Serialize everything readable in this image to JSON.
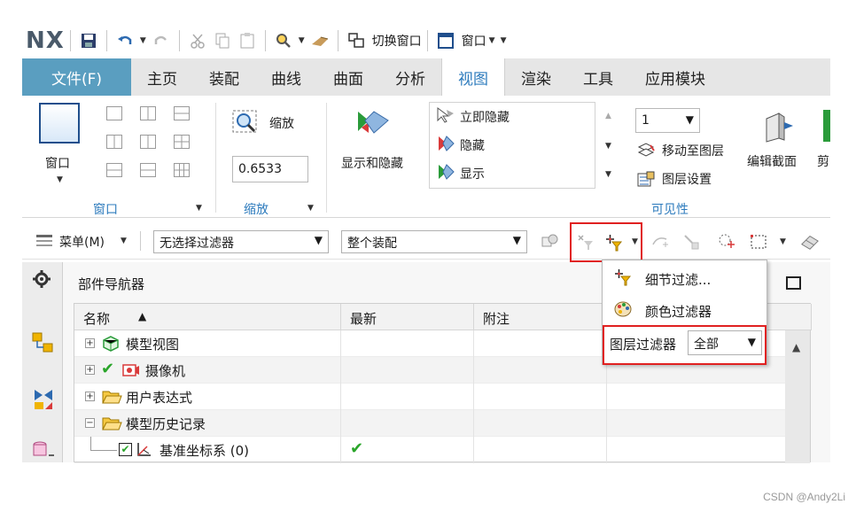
{
  "app": {
    "logo": "NX",
    "quick_access": {
      "switch_window": "切换窗口",
      "window_menu": "窗口"
    }
  },
  "tabs": [
    {
      "label": "文件(F)"
    },
    {
      "label": "主页"
    },
    {
      "label": "装配"
    },
    {
      "label": "曲线"
    },
    {
      "label": "曲面"
    },
    {
      "label": "分析"
    },
    {
      "label": "视图"
    },
    {
      "label": "渲染"
    },
    {
      "label": "工具"
    },
    {
      "label": "应用模块"
    }
  ],
  "active_tab": "视图",
  "ribbon": {
    "window_group": {
      "button": "窗口",
      "label": "窗口"
    },
    "zoom_group": {
      "button": "缩放",
      "value": "0.6533",
      "label": "缩放"
    },
    "show_hide": {
      "button": "显示和隐藏"
    },
    "hide_panel": {
      "items": [
        "立即隐藏",
        "隐藏",
        "显示"
      ]
    },
    "visibility": {
      "layer_value": "1",
      "move_to_layer": "移动至图层",
      "layer_settings": "图层设置",
      "label": "可见性"
    },
    "edit_section": "编辑截面",
    "cut_partial": "剪"
  },
  "selection_bar": {
    "menu": "菜单(M)",
    "filter": "无选择过滤器",
    "scope": "整个装配"
  },
  "navigator": {
    "title": "部件导航器",
    "columns": [
      "名称",
      "最新",
      "附注"
    ],
    "rows": [
      {
        "name": "模型视图",
        "latest": ""
      },
      {
        "name": "摄像机",
        "latest": ""
      },
      {
        "name": "用户表达式",
        "latest": ""
      },
      {
        "name": "模型历史记录",
        "latest": ""
      },
      {
        "name": "基准坐标系 (0)",
        "latest": "✔"
      }
    ]
  },
  "popup": {
    "items": [
      "细节过滤...",
      "颜色过滤器"
    ],
    "layer_filter_label": "图层过滤器",
    "layer_filter_value": "全部"
  },
  "watermark": "CSDN @Andy2Li",
  "colors": {
    "accent": "#2d7bbd",
    "file_tab": "#5a9ec0",
    "highlight": "#e02020",
    "check": "#2aa52a"
  }
}
